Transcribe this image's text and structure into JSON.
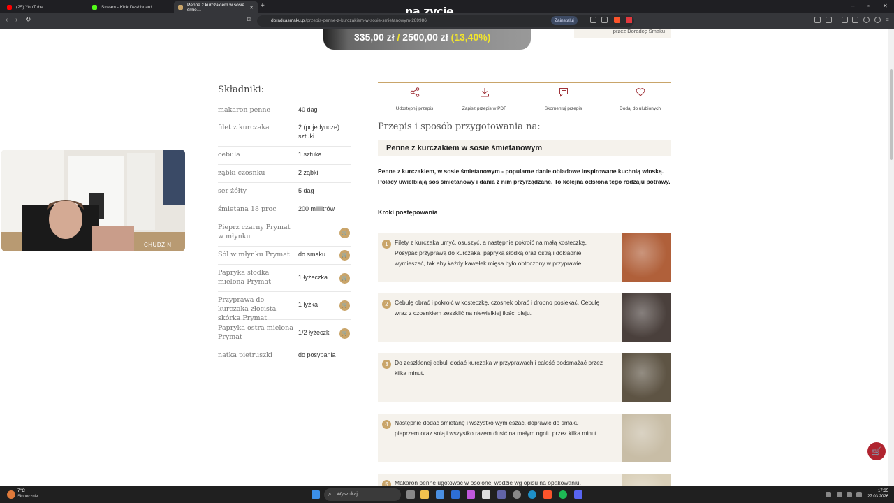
{
  "browser": {
    "tabs": [
      {
        "title": "(25) YouTube",
        "favicon_color": "#ff0000"
      },
      {
        "title": "Stream - Kick Dashboard",
        "favicon_color": "#53fc18"
      },
      {
        "title": "Penne z kurczakiem w sosie śmie…",
        "favicon_color": "#c9a56a"
      }
    ],
    "url_domain": "doradcasmaku.pl",
    "url_path": "/przepis-penne-z-kurczakiem-w-sosie-smietanowym-289986",
    "install_label": "Zainstaluj"
  },
  "overlay_title": "na zycie",
  "price_bar": {
    "current": "335,00 zł",
    "separator": "/",
    "goal": "2500,00 zł",
    "percent": "(13,40%)",
    "progress_fraction": 0.134
  },
  "author_box": "przez Doradcę Smaku",
  "ingredients": {
    "title": "Składniki:",
    "items": [
      {
        "name": "makaron penne",
        "qty": "40 dag",
        "cart": false
      },
      {
        "name": "filet z kurczaka",
        "qty": "2 (pojedyncze) sztuki",
        "cart": false
      },
      {
        "name": "cebula",
        "qty": "1 sztuka",
        "cart": false
      },
      {
        "name": "ząbki czosnku",
        "qty": "2 ząbki",
        "cart": false
      },
      {
        "name": "ser żółty",
        "qty": "5 dag",
        "cart": false
      },
      {
        "name": "śmietana 18 proc",
        "qty": "200 mililitrów",
        "cart": false
      },
      {
        "name": "Pieprz czarny Prymat w młynku",
        "qty": "",
        "cart": true
      },
      {
        "name": "Sól w młynku Prymat",
        "qty": "do smaku",
        "cart": true
      },
      {
        "name": "Papryka słodka mielona Prymat",
        "qty": "1 łyżeczka",
        "cart": true
      },
      {
        "name": "Przyprawa do kurczaka złocista skórka Prymat",
        "qty": "1 łyżka",
        "cart": true
      },
      {
        "name": "Papryka ostra mielona Prymat",
        "qty": "1/2 łyżeczki",
        "cart": true
      },
      {
        "name": "natka pietruszki",
        "qty": "do posypania",
        "cart": false
      }
    ]
  },
  "actions": [
    {
      "label": "Udostępnij przepis",
      "icon": "share-icon"
    },
    {
      "label": "Zapisz przepis w PDF",
      "icon": "download-icon"
    },
    {
      "label": "Skomentuj przepis",
      "icon": "comment-icon"
    },
    {
      "label": "Dodaj do ulubionych",
      "icon": "heart-icon"
    }
  ],
  "prep_heading": "Przepis i sposób przygotowania na:",
  "recipe_name": "Penne z kurczakiem w sosie śmietanowym",
  "intro": "Penne z kurczakiem, w sosie śmietanowym - popularne danie obiadowe inspirowane kuchnią włoską. Polacy uwielbiają sos śmietanowy i dania z nim przyrządzane. To kolejna odsłona tego rodzaju potrawy.",
  "steps_title": "Kroki postępowania",
  "steps": [
    {
      "num": "1",
      "text": "Filety z kurczaka umyć, osuszyć, a następnie pokroić na małą kosteczkę. Posypać przyprawą do kurczaka, papryką słodką oraz ostrą i dokładnie wymieszać, tak aby każdy kawałek mięsa było obtoczony w przyprawie.",
      "photo": "#b0603a"
    },
    {
      "num": "2",
      "text": "Cebulę obrać i pokroić w kosteczkę, czosnek obrać i drobno posiekać. Cebulę wraz z czosnkiem zeszklić na niewielkiej ilości oleju.",
      "photo": "#4a403c"
    },
    {
      "num": "3",
      "text": "Do zeszklonej cebuli dodać kurczaka w przyprawach i całość podsmażać przez kilka minut.",
      "photo": "#5e5444"
    },
    {
      "num": "4",
      "text": "Następnie dodać śmietanę i wszystko wymieszać, doprawić do smaku pieprzem oraz solą i wszystko razem dusić na małym ogniu przez kilka minut.",
      "photo": "#c8bda6"
    },
    {
      "num": "5",
      "text": "Makaron penne ugotować w osolonej wodzie wg opisu na opakowaniu.",
      "photo": "#d9cfb8"
    }
  ],
  "webcam_label": "CHUDZIN",
  "taskbar": {
    "weather_temp": "7°C",
    "weather_desc": "Słonecznie",
    "search_placeholder": "Wyszukaj",
    "time": "17:35",
    "date": "27.03.2026"
  }
}
